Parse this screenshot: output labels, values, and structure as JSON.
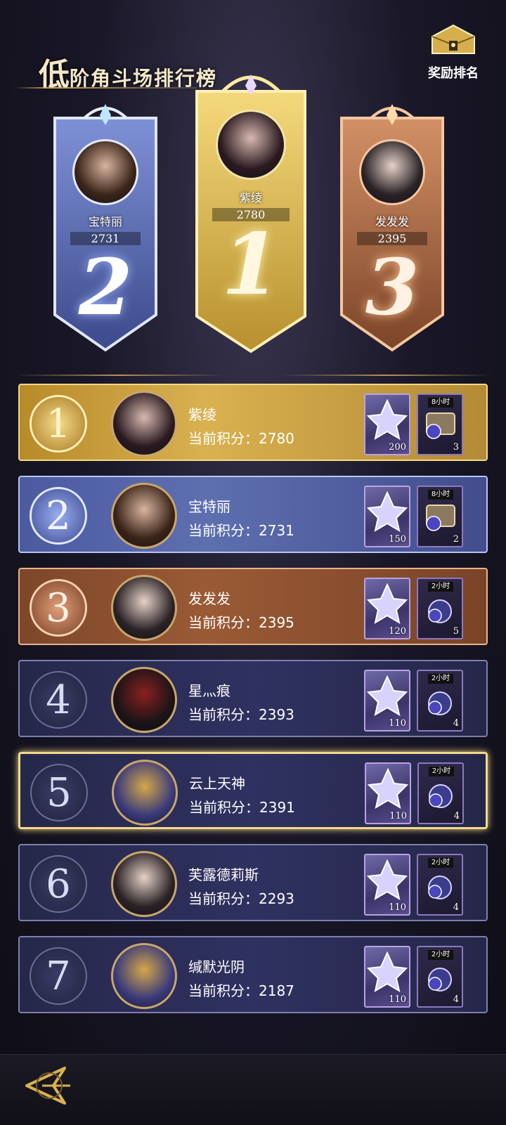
{
  "header": {
    "title_first": "低",
    "title_rest": "阶角斗场排行榜",
    "reward_label": "奖励排名"
  },
  "podium": [
    {
      "rank": "2",
      "name": "宝特丽",
      "score": "2731"
    },
    {
      "rank": "1",
      "name": "紫绫",
      "score": "2780"
    },
    {
      "rank": "3",
      "name": "发发发",
      "score": "2395"
    }
  ],
  "score_prefix": "当前积分：",
  "rows": [
    {
      "rank": "1",
      "name": "紫绫",
      "score_text": "当前积分：2780",
      "item1_count": "200",
      "item2_tag": "8小时",
      "item2_count": "3"
    },
    {
      "rank": "2",
      "name": "宝特丽",
      "score_text": "当前积分：2731",
      "item1_count": "150",
      "item2_tag": "8小时",
      "item2_count": "2"
    },
    {
      "rank": "3",
      "name": "发发发",
      "score_text": "当前积分：2395",
      "item1_count": "120",
      "item2_tag": "2小时",
      "item2_count": "5"
    },
    {
      "rank": "4",
      "name": "星灬痕",
      "score_text": "当前积分：2393",
      "item1_count": "110",
      "item2_tag": "2小时",
      "item2_count": "4"
    },
    {
      "rank": "5",
      "name": "云上天神",
      "score_text": "当前积分：2391",
      "item1_count": "110",
      "item2_tag": "2小时",
      "item2_count": "4"
    },
    {
      "rank": "6",
      "name": "芙露德莉斯",
      "score_text": "当前积分：2293",
      "item1_count": "110",
      "item2_tag": "2小时",
      "item2_count": "4"
    },
    {
      "rank": "7",
      "name": "缄默光阴",
      "score_text": "当前积分：2187",
      "item1_count": "110",
      "item2_tag": "2小时",
      "item2_count": "4"
    }
  ],
  "icons": {
    "reward": "treasure-chest-icon",
    "item1": "crystal-star-icon",
    "item2": "exp-chest-icon",
    "back": "back-arrow-icon"
  },
  "colors": {
    "gold": "#d9b150",
    "silver_blue": "#5e6fb0",
    "bronze": "#9a5a35",
    "dark_row": "#2b2d52",
    "highlight": "#f2d98a"
  }
}
